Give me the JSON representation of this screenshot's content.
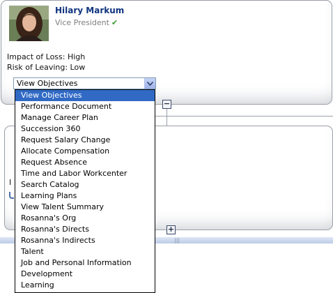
{
  "profile": {
    "name": "Hilary Markum",
    "title": "Vice President",
    "impact": "Impact of Loss: High",
    "risk": "Risk of Leaving: Low"
  },
  "action_select": {
    "value": "View Objectives",
    "options": [
      "View Objectives",
      "Performance Document",
      "Manage Career Plan",
      "Succession 360",
      "Request Salary Change",
      "Allocate Compensation",
      "Request Absence",
      "Time and Labor Workcenter",
      "Search Catalog",
      "Learning Plans",
      "View Talent Summary",
      "Rosanna's Org",
      "Rosanna's Directs",
      "Rosanna's Indirects",
      "Talent",
      "Job and Personal Information",
      "Development",
      "Learning"
    ]
  },
  "toggles": {
    "collapse": "−",
    "expand": "+"
  },
  "partial_text": {
    "bottom_card_letter": "I"
  },
  "icons": {
    "check": "checkmark-icon",
    "dropdown": "chevron-down-icon",
    "grip": "splitter-grip-icon"
  },
  "colors": {
    "name": "#10347e",
    "selection": "#316ac5",
    "check": "#3c9a35"
  }
}
